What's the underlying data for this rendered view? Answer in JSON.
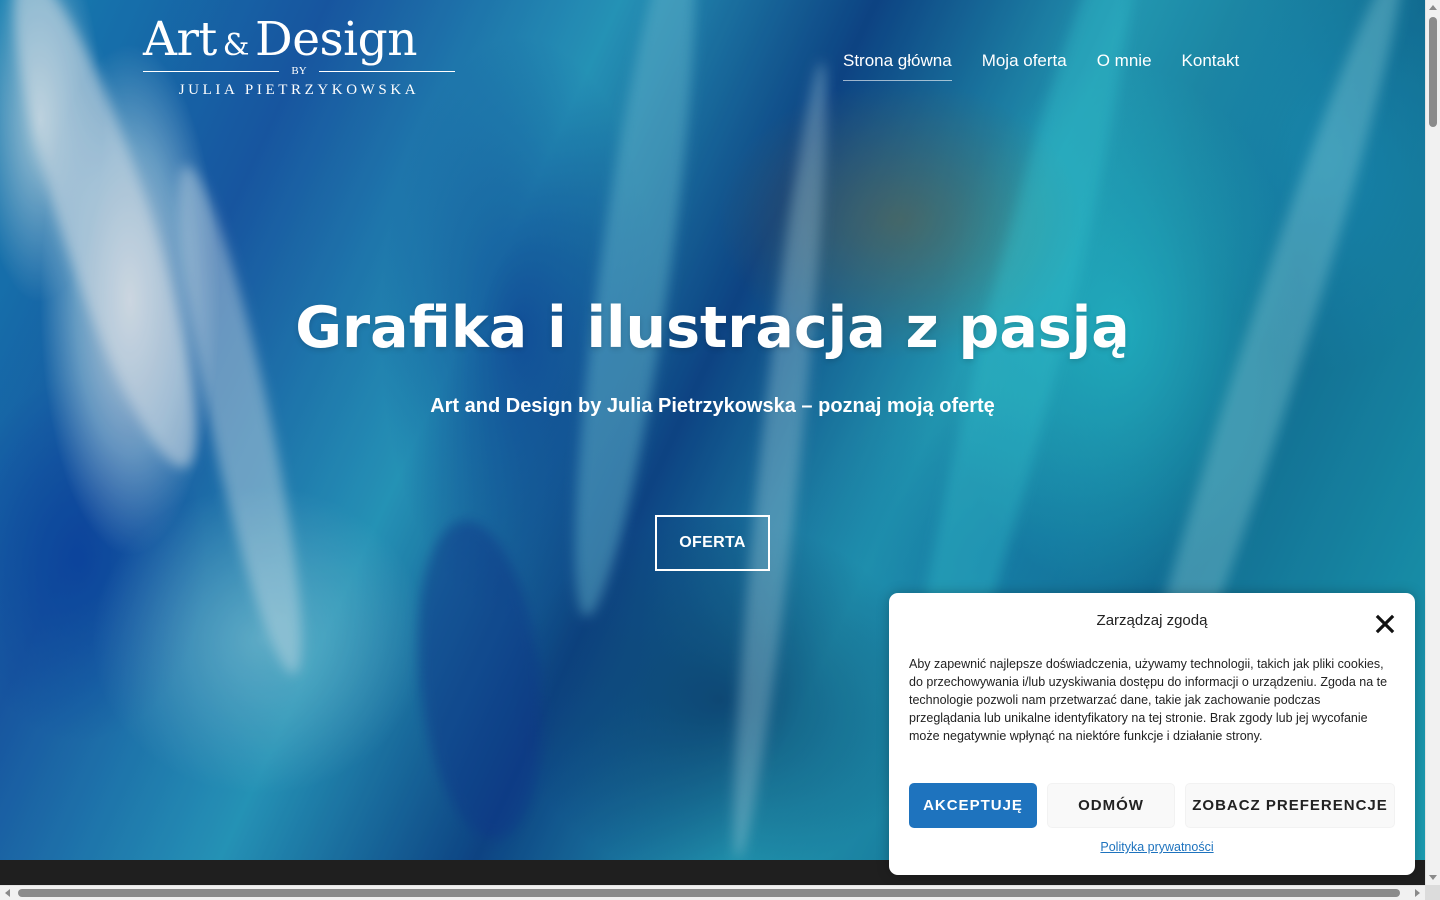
{
  "site": {
    "logo_main": "Art",
    "logo_amp": "&",
    "logo_main2": "Design",
    "logo_by": "BY",
    "logo_sub": "JULIA PIETRZYKOWSKA"
  },
  "nav": {
    "items": [
      {
        "label": "Strona główna",
        "active": true
      },
      {
        "label": "Moja oferta"
      },
      {
        "label": "O mnie"
      },
      {
        "label": "Kontakt"
      }
    ]
  },
  "hero": {
    "title": "Grafika i ilustracja z pasją",
    "subtitle": "Art and Design by Julia Pietrzykowska – poznaj moją ofertę",
    "cta_label": "OFERTA"
  },
  "consent": {
    "title": "Zarządzaj zgodą",
    "text": "Aby zapewnić najlepsze doświadczenia, używamy technologii, takich jak pliki cookies, do przechowywania i/lub uzyskiwania dostępu do informacji o urządzeniu. Zgoda na te technologie pozwoli nam przetwarzać dane, takie jak zachowanie podczas przeglądania lub unikalne identyfikatory na tej stronie. Brak zgody lub jej wycofanie może negatywnie wpłynąć na niektóre funkcje i działanie strony.",
    "accept_label": "AKCEPTUJĘ",
    "deny_label": "ODMÓW",
    "prefs_label": "ZOBACZ PREFERENCJE",
    "privacy_label": "Polityka prywatności",
    "accent_color": "#1e73be"
  },
  "icons": {
    "close": "close-icon"
  }
}
